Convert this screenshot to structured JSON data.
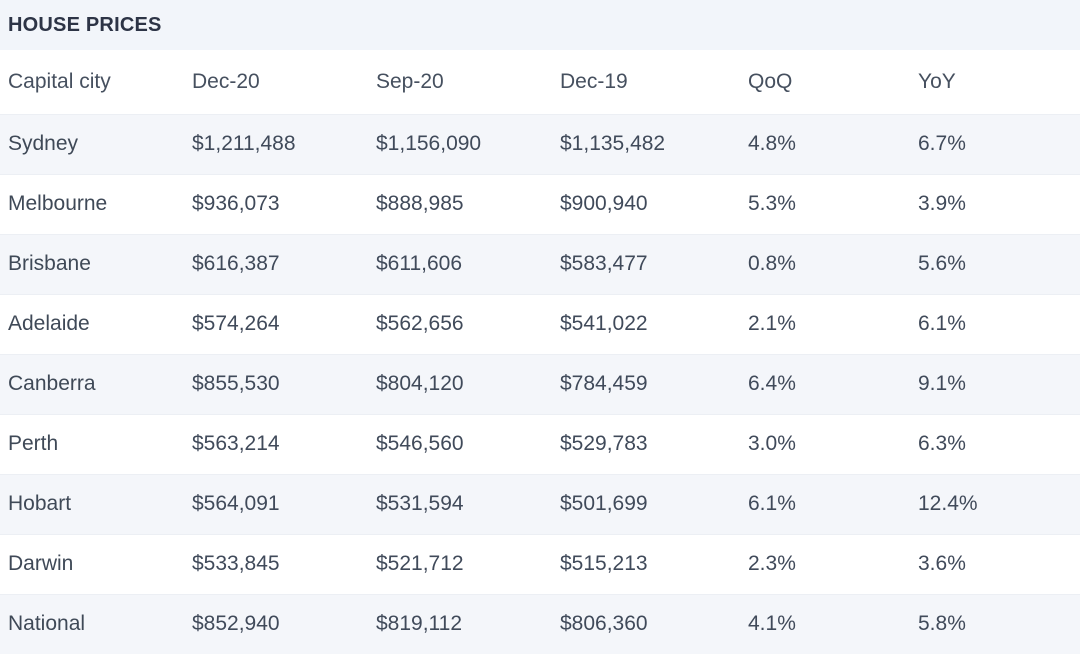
{
  "header": {
    "title": "HOUSE PRICES"
  },
  "colors": {
    "title_band_bg": "#f2f5fa",
    "title_text": "#2d3446",
    "row_stripe_bg": "#f4f6fa",
    "row_bg": "#ffffff",
    "body_text": "#404a5a",
    "header_text": "#46505f",
    "row_divider": "#eceff4"
  },
  "table": {
    "columns": [
      {
        "key": "city",
        "label": "Capital city"
      },
      {
        "key": "dec20",
        "label": "Dec-20"
      },
      {
        "key": "sep20",
        "label": "Sep-20"
      },
      {
        "key": "dec19",
        "label": "Dec-19"
      },
      {
        "key": "qoq",
        "label": "QoQ"
      },
      {
        "key": "yoy",
        "label": "YoY"
      }
    ],
    "rows": [
      {
        "city": "Sydney",
        "dec20": "$1,211,488",
        "sep20": "$1,156,090",
        "dec19": "$1,135,482",
        "qoq": "4.8%",
        "yoy": "6.7%"
      },
      {
        "city": "Melbourne",
        "dec20": "$936,073",
        "sep20": "$888,985",
        "dec19": "$900,940",
        "qoq": "5.3%",
        "yoy": "3.9%"
      },
      {
        "city": "Brisbane",
        "dec20": "$616,387",
        "sep20": "$611,606",
        "dec19": "$583,477",
        "qoq": "0.8%",
        "yoy": "5.6%"
      },
      {
        "city": "Adelaide",
        "dec20": "$574,264",
        "sep20": "$562,656",
        "dec19": "$541,022",
        "qoq": "2.1%",
        "yoy": "6.1%"
      },
      {
        "city": "Canberra",
        "dec20": "$855,530",
        "sep20": "$804,120",
        "dec19": "$784,459",
        "qoq": "6.4%",
        "yoy": "9.1%"
      },
      {
        "city": "Perth",
        "dec20": "$563,214",
        "sep20": "$546,560",
        "dec19": "$529,783",
        "qoq": "3.0%",
        "yoy": "6.3%"
      },
      {
        "city": "Hobart",
        "dec20": "$564,091",
        "sep20": "$531,594",
        "dec19": "$501,699",
        "qoq": "6.1%",
        "yoy": "12.4%"
      },
      {
        "city": "Darwin",
        "dec20": "$533,845",
        "sep20": "$521,712",
        "dec19": "$515,213",
        "qoq": "2.3%",
        "yoy": "3.6%"
      },
      {
        "city": "National",
        "dec20": "$852,940",
        "sep20": "$819,112",
        "dec19": "$806,360",
        "qoq": "4.1%",
        "yoy": "5.8%"
      }
    ]
  },
  "chart_data": {
    "type": "table",
    "title": "HOUSE PRICES",
    "columns": [
      "Capital city",
      "Dec-20",
      "Sep-20",
      "Dec-19",
      "QoQ",
      "YoY"
    ],
    "rows": [
      [
        "Sydney",
        "$1,211,488",
        "$1,156,090",
        "$1,135,482",
        "4.8%",
        "6.7%"
      ],
      [
        "Melbourne",
        "$936,073",
        "$888,985",
        "$900,940",
        "5.3%",
        "3.9%"
      ],
      [
        "Brisbane",
        "$616,387",
        "$611,606",
        "$583,477",
        "0.8%",
        "5.6%"
      ],
      [
        "Adelaide",
        "$574,264",
        "$562,656",
        "$541,022",
        "2.1%",
        "6.1%"
      ],
      [
        "Canberra",
        "$855,530",
        "$804,120",
        "$784,459",
        "6.4%",
        "9.1%"
      ],
      [
        "Perth",
        "$563,214",
        "$546,560",
        "$529,783",
        "3.0%",
        "6.3%"
      ],
      [
        "Hobart",
        "$564,091",
        "$531,594",
        "$501,699",
        "6.1%",
        "12.4%"
      ],
      [
        "Darwin",
        "$533,845",
        "$521,712",
        "$515,213",
        "2.3%",
        "3.6%"
      ],
      [
        "National",
        "$852,940",
        "$819,112",
        "$806,360",
        "4.1%",
        "5.8%"
      ]
    ]
  }
}
